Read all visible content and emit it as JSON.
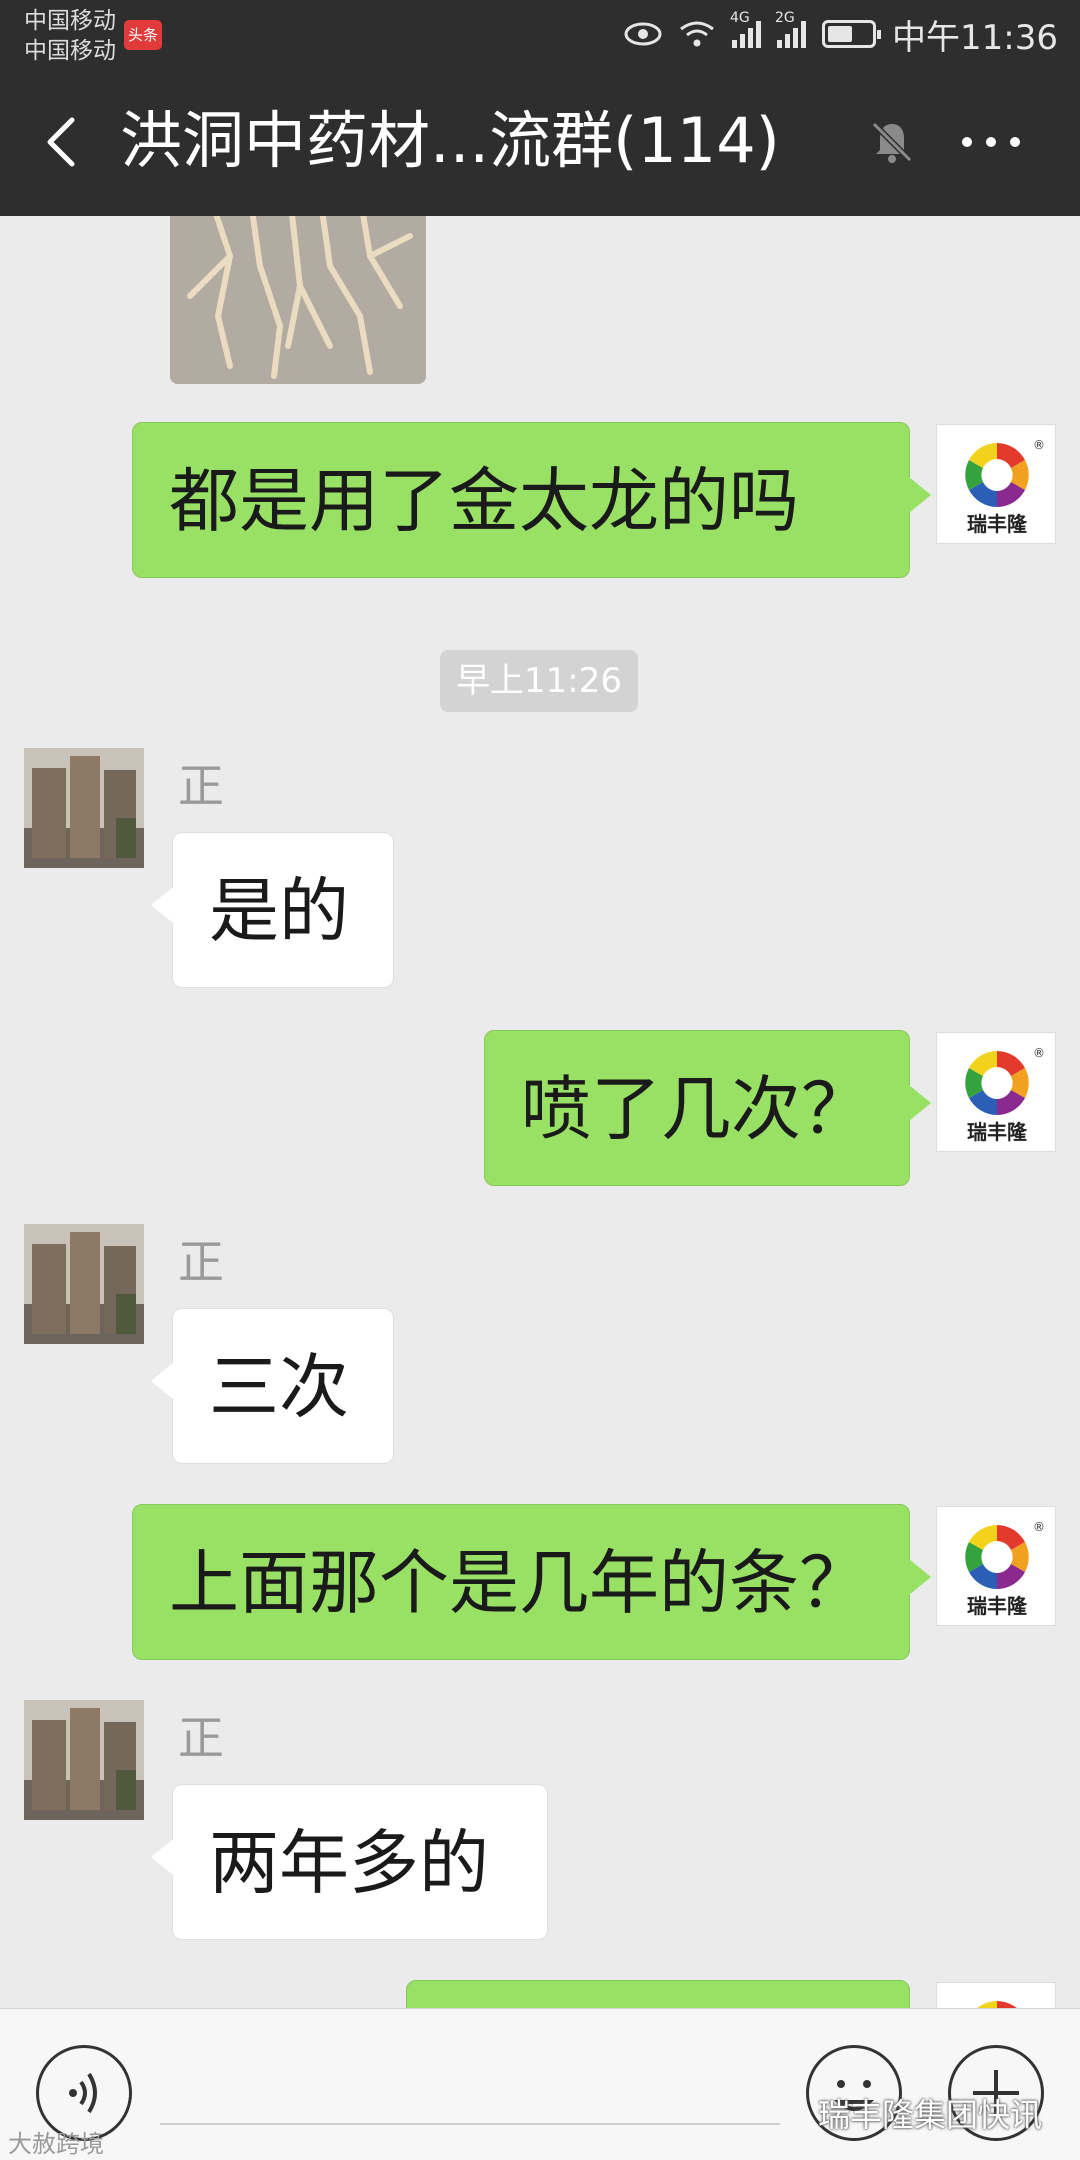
{
  "status_bar": {
    "carrier_1": "中国移动",
    "carrier_2": "中国移动",
    "badge": "头条",
    "net_1": "4G",
    "net_2": "2G",
    "time": "中午11:36"
  },
  "header": {
    "title": "洪洞中药材...流群(114)",
    "back_icon": "chevron-left-icon",
    "mute_icon": "bell-off-icon",
    "more_icon": "more-dots-icon"
  },
  "chat": {
    "timestamp": "早上11:26",
    "messages": [
      {
        "sender": "me",
        "text": "都是用了金太龙的吗"
      },
      {
        "sender": "them",
        "name": "正",
        "text": "是的"
      },
      {
        "sender": "me",
        "text": "喷了几次？"
      },
      {
        "sender": "them",
        "name": "正",
        "text": "三次"
      },
      {
        "sender": "me",
        "text": "上面那个是几年的条？"
      },
      {
        "sender": "them",
        "name": "正",
        "text": "两年多的"
      }
    ],
    "logo_text": "瑞丰隆",
    "logo_mark": "®"
  },
  "input_bar": {
    "voice_icon": "voice-icon",
    "emoji_icon": "emoji-icon",
    "plus_icon": "plus-icon"
  },
  "watermarks": {
    "left": "大赦跨境",
    "right": "瑞丰隆集团快讯"
  },
  "colors": {
    "header_bg": "#2e2e2e",
    "my_bubble": "#98e165",
    "their_bubble": "#ffffff",
    "chat_bg": "#ebebeb"
  }
}
